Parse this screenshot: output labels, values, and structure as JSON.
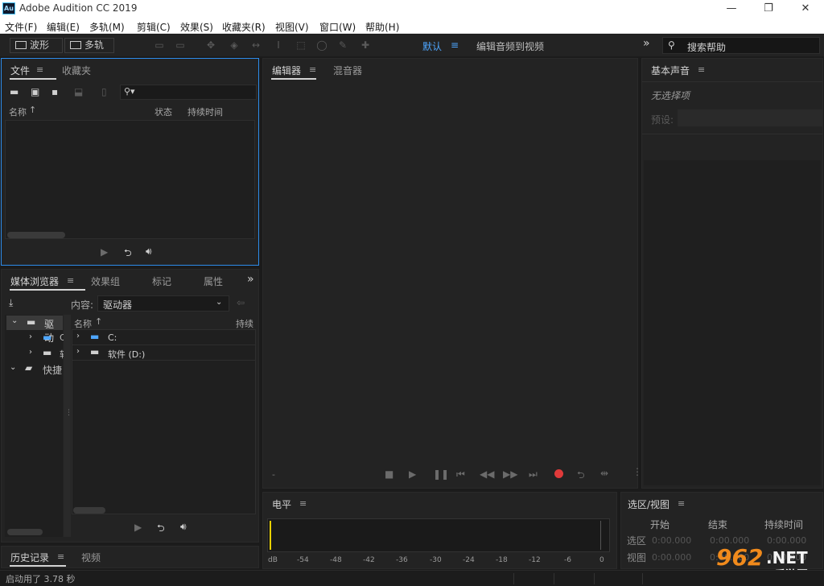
{
  "window": {
    "app_icon": "Au",
    "title": "Adobe Audition CC 2019",
    "minimize": "—",
    "restore": "❐",
    "close": "✕"
  },
  "menu": [
    "文件(F)",
    "编辑(E)",
    "多轨(M)",
    "剪辑(C)",
    "效果(S)",
    "收藏夹(R)",
    "视图(V)",
    "窗口(W)",
    "帮助(H)"
  ],
  "toolbar": {
    "waveform_label": "波形",
    "multitrack_label": "多轨",
    "workspace_default": "默认",
    "workspace_edit_video": "编辑音频到视频",
    "overflow": "»",
    "search_placeholder": "搜索帮助"
  },
  "files_panel": {
    "tab_files": "文件",
    "tab_favorites": "收藏夹",
    "col_name": "名称",
    "col_status": "状态",
    "col_duration": "持续时间"
  },
  "media_panel": {
    "tab_media": "媒体浏览器",
    "tab_effects": "效果组",
    "tab_markers": "标记",
    "tab_properties": "属性",
    "overflow": "»",
    "content_label": "内容:",
    "content_value": "驱动器",
    "tree": [
      {
        "label": "驱动"
      },
      {
        "label": "C"
      },
      {
        "label": "软"
      },
      {
        "label": "快捷"
      }
    ],
    "col_name": "名称",
    "col_duration": "持续",
    "drives": [
      {
        "label": "C:"
      },
      {
        "label": "软件 (D:)"
      }
    ]
  },
  "editor_panel": {
    "tab_editor": "编辑器",
    "tab_mixer": "混音器",
    "dash": "-"
  },
  "essential_sound": {
    "title": "基本声音",
    "no_selection": "无选择项",
    "preset_label": "预设:"
  },
  "levels_panel": {
    "title": "电平",
    "db_label": "dB",
    "ticks": [
      "-54",
      "-48",
      "-42",
      "-36",
      "-30",
      "-24",
      "-18",
      "-12",
      "-6",
      "0"
    ]
  },
  "selection_panel": {
    "title": "选区/视图",
    "col_start": "开始",
    "col_end": "结束",
    "col_duration": "持续时间",
    "row_selection": "选区",
    "row_view": "视图",
    "values": [
      "0:00.000",
      "0:00.000",
      "0:00.000",
      "0:00.000",
      "0:00.000",
      "0:00.000"
    ]
  },
  "history_panel": {
    "tab_history": "历史记录",
    "tab_video": "视频"
  },
  "status": {
    "startup": "启动用了 3.78 秒"
  },
  "watermark": {
    "logo": "962",
    "net": ".NET",
    "sub": "乐游网"
  },
  "colors": {
    "accent_blue": "#2d8ceb",
    "record_red": "#e03a3a",
    "playhead_yellow": "#e8d000"
  }
}
